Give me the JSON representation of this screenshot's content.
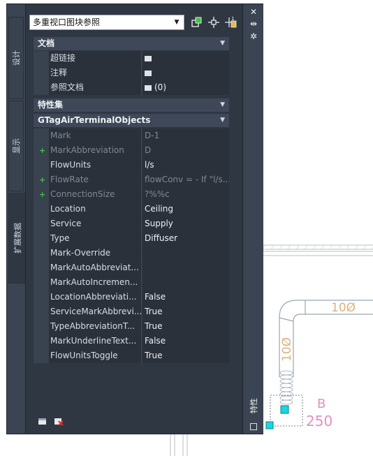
{
  "palette": {
    "tabs": [
      "设计",
      "显示",
      "扩展数据"
    ],
    "active_tab": "扩展数据",
    "title": "特性",
    "selector_value": "多重视口图块参照"
  },
  "sections": {
    "docs": {
      "title": "文档",
      "rows": [
        {
          "label": "超链接",
          "value": ""
        },
        {
          "label": "注释",
          "value": ""
        },
        {
          "label": "参照文档",
          "value": "(0)"
        }
      ]
    },
    "propsets": {
      "title": "特性集"
    },
    "gtag": {
      "title": "GTagAirTerminalObjects",
      "rows": [
        {
          "label": "Mark",
          "value": "D-1"
        },
        {
          "label": "MarkAbbreviation",
          "value": "D"
        },
        {
          "label": "FlowUnits",
          "value": "l/s"
        },
        {
          "label": "FlowRate",
          "value": "flowConv = - If \"l/s..."
        },
        {
          "label": "ConnectionSize",
          "value": "?%%c"
        },
        {
          "label": "Location",
          "value": "Ceiling"
        },
        {
          "label": "Service",
          "value": "Supply"
        },
        {
          "label": "Type",
          "value": "Diffuser"
        },
        {
          "label": "Mark-Override",
          "value": ""
        },
        {
          "label": "MarkAutoAbbreviat...",
          "value": ""
        },
        {
          "label": "MarkAutoIncremen...",
          "value": ""
        },
        {
          "label": "LocationAbbreviati...",
          "value": "False"
        },
        {
          "label": "ServiceMarkAbbrevi...",
          "value": "True"
        },
        {
          "label": "TypeAbbreviationT...",
          "value": "True"
        },
        {
          "label": "MarkUnderlineText...",
          "value": "False"
        },
        {
          "label": "FlowUnitsToggle",
          "value": "True"
        }
      ]
    }
  },
  "drawing": {
    "duct_label_h": "10Ø",
    "duct_label_v": "10Ø",
    "tag_letter": "B",
    "tag_number": "250",
    "colors": {
      "duct": "#9aa6b2",
      "duct_text": "#d9b47c",
      "tag": "#e58fc0",
      "grip": "#19d6e0"
    }
  },
  "icons": {
    "top": [
      "quick-select-icon",
      "select-objects-icon",
      "pickadd-icon"
    ],
    "titlebar": [
      "close-icon",
      "auto-hide-icon",
      "properties-settings-icon",
      "palette-menu-icon"
    ],
    "bottom": [
      "edit-icon",
      "delete-icon"
    ]
  }
}
